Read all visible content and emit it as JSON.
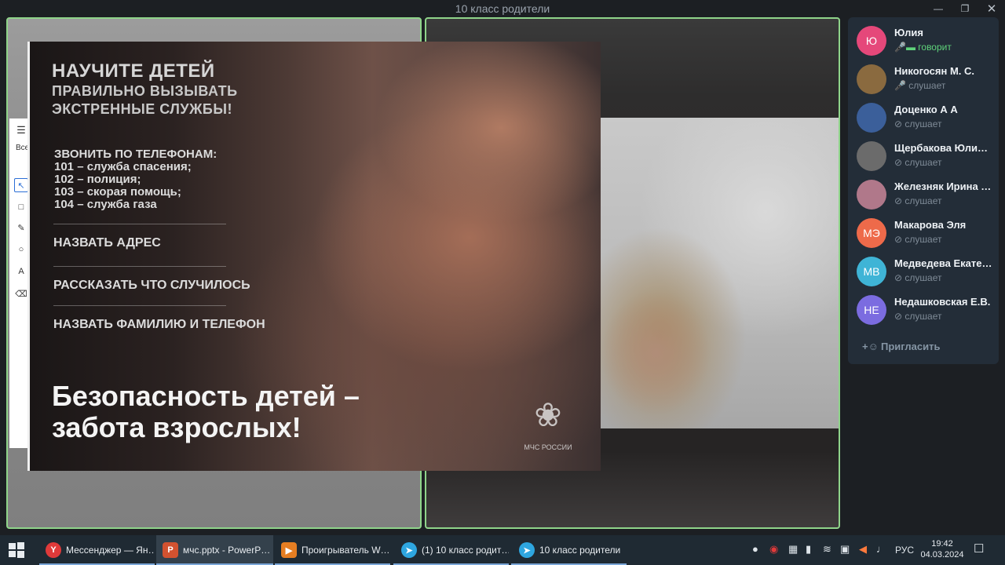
{
  "window": {
    "title": "10 класс родители"
  },
  "shared_screen": {
    "label": "Все"
  },
  "slide": {
    "headline": [
      "НАУЧИТЕ ДЕТЕЙ",
      "ПРАВИЛЬНО ВЫЗЫВАТЬ",
      "ЭКСТРЕННЫЕ СЛУЖБЫ!"
    ],
    "phones_header": "ЗВОНИТЬ ПО ТЕЛЕФОНАМ:",
    "phones": [
      "101 – служба спасения;",
      "102 – полиция;",
      "103 – скорая помощь;",
      "104 – служба газа"
    ],
    "actions": [
      "НАЗВАТЬ АДРЕС",
      "РАССКАЗАТЬ ЧТО СЛУЧИЛОСЬ",
      "НАЗВАТЬ ФАМИЛИЮ И ТЕЛЕФОН"
    ],
    "slogan": [
      "Безопасность детей –",
      "забота взрослых!"
    ],
    "emblem_caption": "МЧС РОССИИ"
  },
  "participants": [
    {
      "name": "Юлия",
      "initials": "Ю",
      "status": "говорит",
      "color": "#e5487a",
      "speaking": true
    },
    {
      "name": "Никогосян М. С.",
      "initials": "",
      "status": "слушает",
      "color": "#8a6a3f",
      "speaking": false
    },
    {
      "name": "Доценко А А",
      "initials": "",
      "status": "слушает",
      "color": "#3b5f9a",
      "speaking": false
    },
    {
      "name": "Щербакова Юлия…",
      "initials": "",
      "status": "слушает",
      "color": "#6b6b6b",
      "speaking": false
    },
    {
      "name": "Железняк Ирина …",
      "initials": "",
      "status": "слушает",
      "color": "#b0788a",
      "speaking": false
    },
    {
      "name": "Макарова Эля",
      "initials": "МЭ",
      "status": "слушает",
      "color": "#ee6a4a",
      "speaking": false
    },
    {
      "name": "Медведева Екате…",
      "initials": "МВ",
      "status": "слушает",
      "color": "#3fb4d6",
      "speaking": false
    },
    {
      "name": "Недашковская Е.В.",
      "initials": "НЕ",
      "status": "слушает",
      "color": "#7b6ce0",
      "speaking": false
    }
  ],
  "invite_label": "Пригласить",
  "taskbar": {
    "items": [
      {
        "label": "Мессенджер — Ян…",
        "icon": "yandex-icon",
        "color": "#e03a3a",
        "glyph": "Y"
      },
      {
        "label": "мчс.pptx - PowerP…",
        "icon": "powerpoint-icon",
        "color": "#d35230",
        "glyph": "P"
      },
      {
        "label": "Проигрыватель W…",
        "icon": "media-player-icon",
        "color": "#e67e22",
        "glyph": "▶"
      },
      {
        "label": "(1) 10 класс родит…",
        "icon": "telegram-icon",
        "color": "#2ea6e0",
        "glyph": "➤"
      },
      {
        "label": "10 класс родители",
        "icon": "telegram-icon",
        "color": "#2ea6e0",
        "glyph": "➤"
      }
    ],
    "language": "РУС",
    "time": "19:42",
    "date": "04.03.2024"
  }
}
